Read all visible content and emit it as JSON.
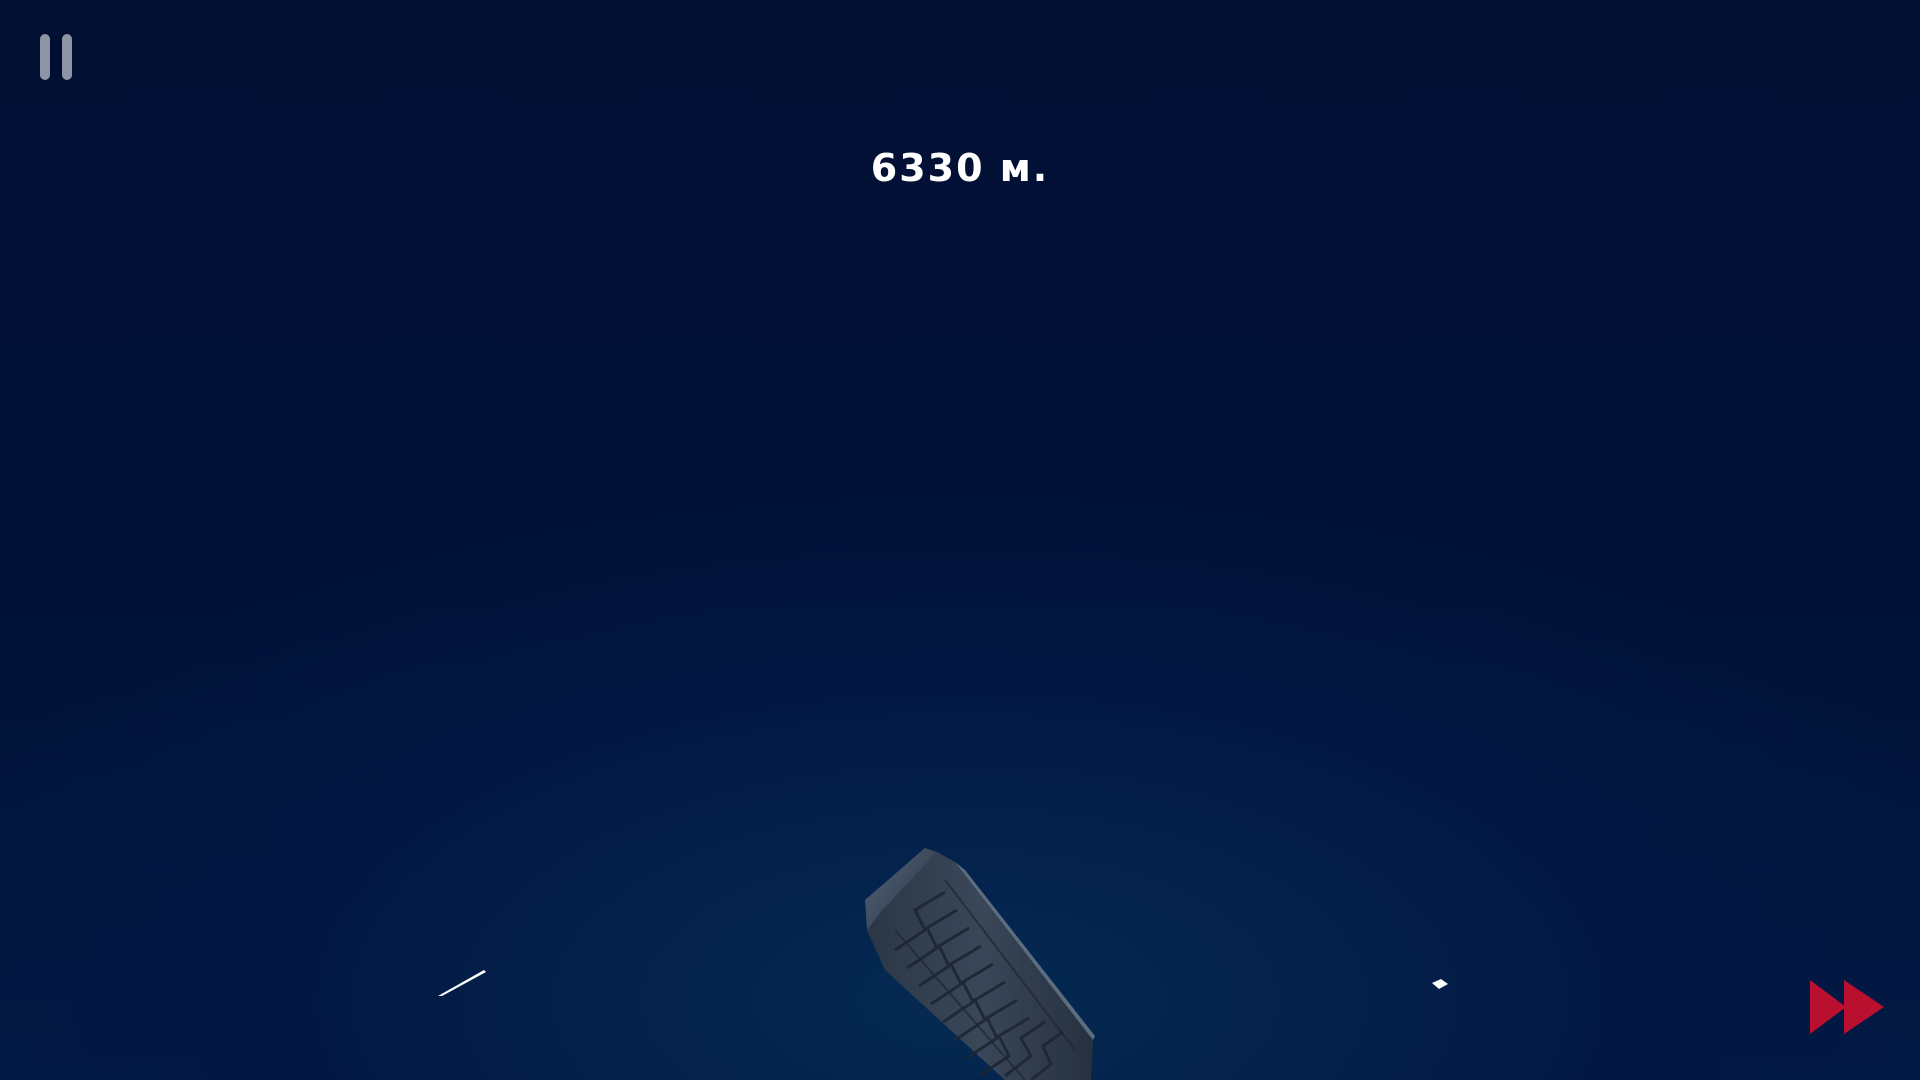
{
  "hud": {
    "pause_icon": "pause-icon",
    "distance_text": "6330 м.",
    "fast_forward_icon": "fast-forward-icon"
  },
  "colors": {
    "background": "#011034",
    "pause_icon": "#8d95a4",
    "distance_text": "#ffffff",
    "fast_forward": "#b8102e"
  }
}
